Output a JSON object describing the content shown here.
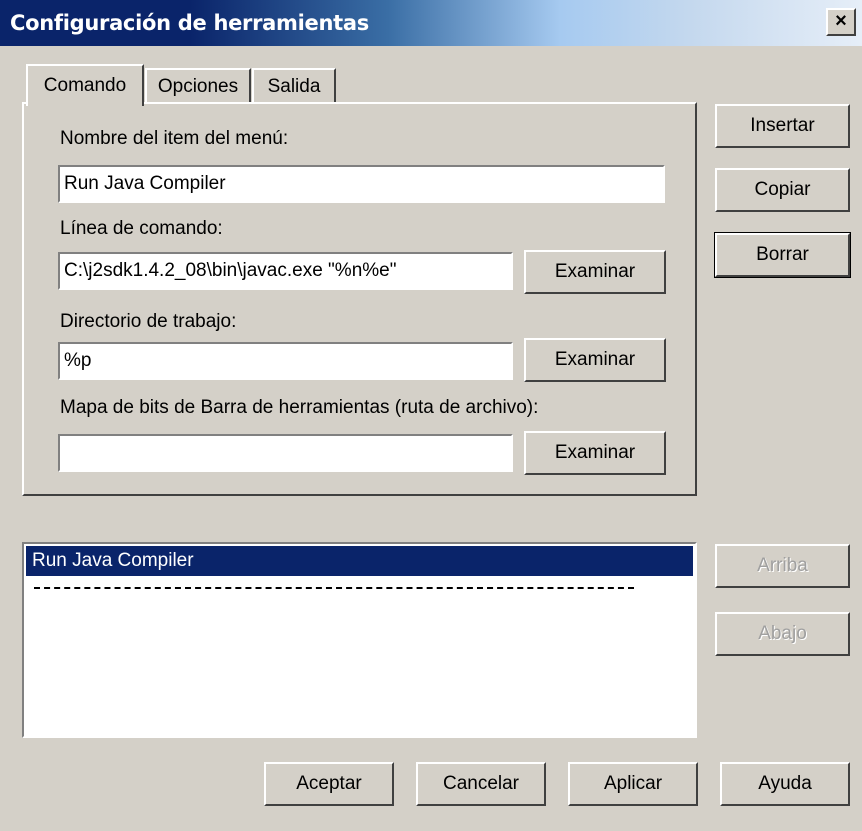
{
  "window": {
    "title": "Configuración de herramientas",
    "close": "×"
  },
  "tabs": [
    {
      "label": "Comando"
    },
    {
      "label": "Opciones"
    },
    {
      "label": "Salida"
    }
  ],
  "form": {
    "menu_name_label": "Nombre del item del menú:",
    "menu_name_value": "Run Java Compiler",
    "command_label": "Línea de comando:",
    "command_value": "C:\\j2sdk1.4.2_08\\bin\\javac.exe \"%n%e\"",
    "workdir_label": "Directorio de trabajo:",
    "workdir_value": "%p",
    "bitmap_label": "Mapa de bits de Barra de herramientas (ruta de archivo):",
    "bitmap_value": "",
    "browse_label": "Examinar"
  },
  "side_buttons": {
    "insert": "Insertar",
    "copy": "Copiar",
    "delete": "Borrar",
    "up": "Arriba",
    "down": "Abajo"
  },
  "list": {
    "items": [
      "Run Java Compiler"
    ],
    "selected": "Run Java Compiler"
  },
  "footer": {
    "ok": "Aceptar",
    "cancel": "Cancelar",
    "apply": "Aplicar",
    "help": "Ayuda"
  }
}
